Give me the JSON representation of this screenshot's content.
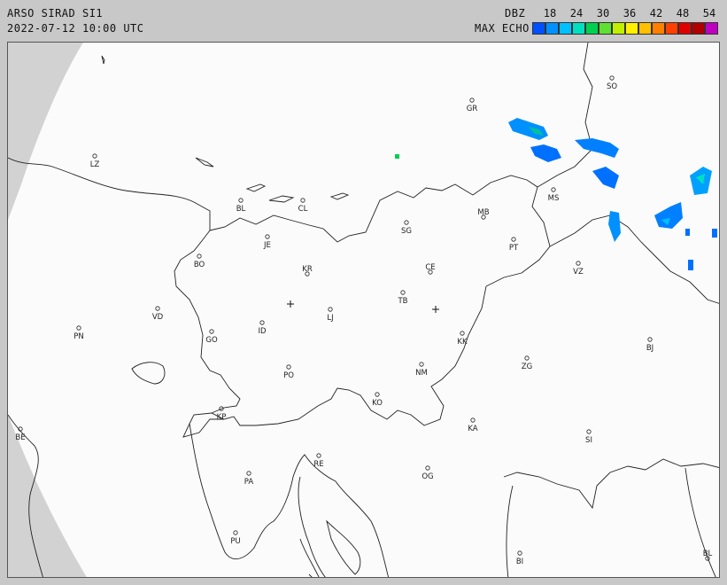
{
  "header": {
    "title": "ARSO SIRAD SI1",
    "timestamp": "2022-07-12 10:00 UTC",
    "unit": "DBZ",
    "mode": "MAX ECHO"
  },
  "scale": {
    "ticks": [
      "18",
      "24",
      "30",
      "36",
      "42",
      "48",
      "54"
    ],
    "colors": [
      "#0050ff",
      "#0090ff",
      "#00c0ff",
      "#00e0c0",
      "#00d050",
      "#60e030",
      "#c0f000",
      "#fff000",
      "#ffc000",
      "#ff8000",
      "#ff4000",
      "#e00000",
      "#b00000",
      "#c000c0"
    ]
  },
  "cities": [
    {
      "name": "SO"
    },
    {
      "name": "GR"
    },
    {
      "name": "LZ"
    },
    {
      "name": "BL"
    },
    {
      "name": "CL"
    },
    {
      "name": "MS"
    },
    {
      "name": "MB"
    },
    {
      "name": "SG"
    },
    {
      "name": "JE"
    },
    {
      "name": "PT"
    },
    {
      "name": "BO"
    },
    {
      "name": "KR"
    },
    {
      "name": "CE"
    },
    {
      "name": "VZ"
    },
    {
      "name": "TB"
    },
    {
      "name": "VD"
    },
    {
      "name": "LJ"
    },
    {
      "name": "PN"
    },
    {
      "name": "ID"
    },
    {
      "name": "GO"
    },
    {
      "name": "KK"
    },
    {
      "name": "BJ"
    },
    {
      "name": "ZG"
    },
    {
      "name": "PO"
    },
    {
      "name": "NM"
    },
    {
      "name": "KO"
    },
    {
      "name": "KP"
    },
    {
      "name": "KA"
    },
    {
      "name": "SI"
    },
    {
      "name": "BE"
    },
    {
      "name": "RE"
    },
    {
      "name": "PA"
    },
    {
      "name": "OG"
    },
    {
      "name": "PU"
    },
    {
      "name": "BI"
    },
    {
      "name": "BL"
    }
  ]
}
